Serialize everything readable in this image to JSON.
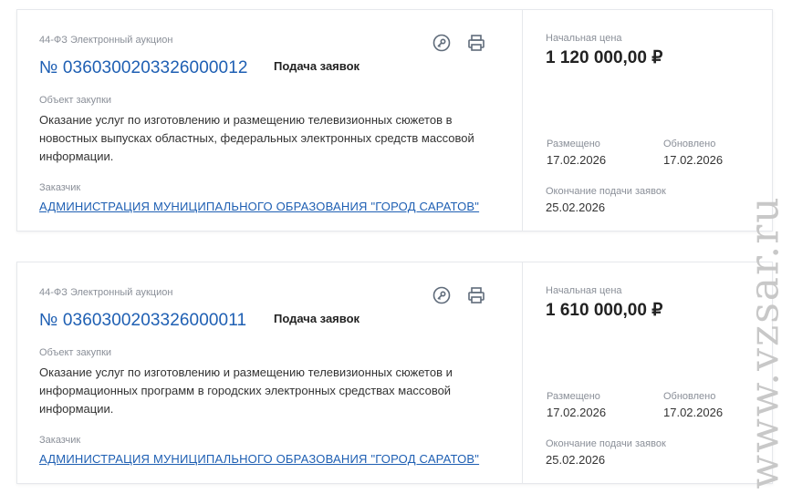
{
  "cards": [
    {
      "law": "44-ФЗ Электронный аукцион",
      "number": "№ 0360300203326000012",
      "stage": "Подача заявок",
      "object_label": "Объект закупки",
      "object": "Оказание услуг по изготовлению и размещению телевизионных сюжетов в новостных выпусках областных, федеральных электронных средств массовой информации.",
      "customer_label": "Заказчик",
      "customer": "АДМИНИСТРАЦИЯ МУНИЦИПАЛЬНОГО ОБРАЗОВАНИЯ \"ГОРОД САРАТОВ\"",
      "price_label": "Начальная цена",
      "price": "1 120 000,00 ₽",
      "published_label": "Размещено",
      "published": "17.02.2026",
      "updated_label": "Обновлено",
      "updated": "17.02.2026",
      "deadline_label": "Окончание подачи заявок",
      "deadline": "25.02.2026"
    },
    {
      "law": "44-ФЗ Электронный аукцион",
      "number": "№ 0360300203326000011",
      "stage": "Подача заявок",
      "object_label": "Объект закупки",
      "object": "Оказание услуг по изготовлению и размещению телевизионных сюжетов и информационных программ в городских электронных средствах массовой информации.",
      "customer_label": "Заказчик",
      "customer": "АДМИНИСТРАЦИЯ МУНИЦИПАЛЬНОГО ОБРАЗОВАНИЯ \"ГОРОД САРАТОВ\"",
      "price_label": "Начальная цена",
      "price": "1 610 000,00 ₽",
      "published_label": "Размещено",
      "published": "17.02.2026",
      "updated_label": "Обновлено",
      "updated": "17.02.2026",
      "deadline_label": "Окончание подачи заявок",
      "deadline": "25.02.2026"
    }
  ],
  "icons": {
    "key": "key-icon",
    "print": "printer-icon"
  },
  "colors": {
    "link": "#1e5fb3",
    "muted": "#8a8f98",
    "icon": "#5f6b7a"
  },
  "watermark": "www.vzsar.ru"
}
